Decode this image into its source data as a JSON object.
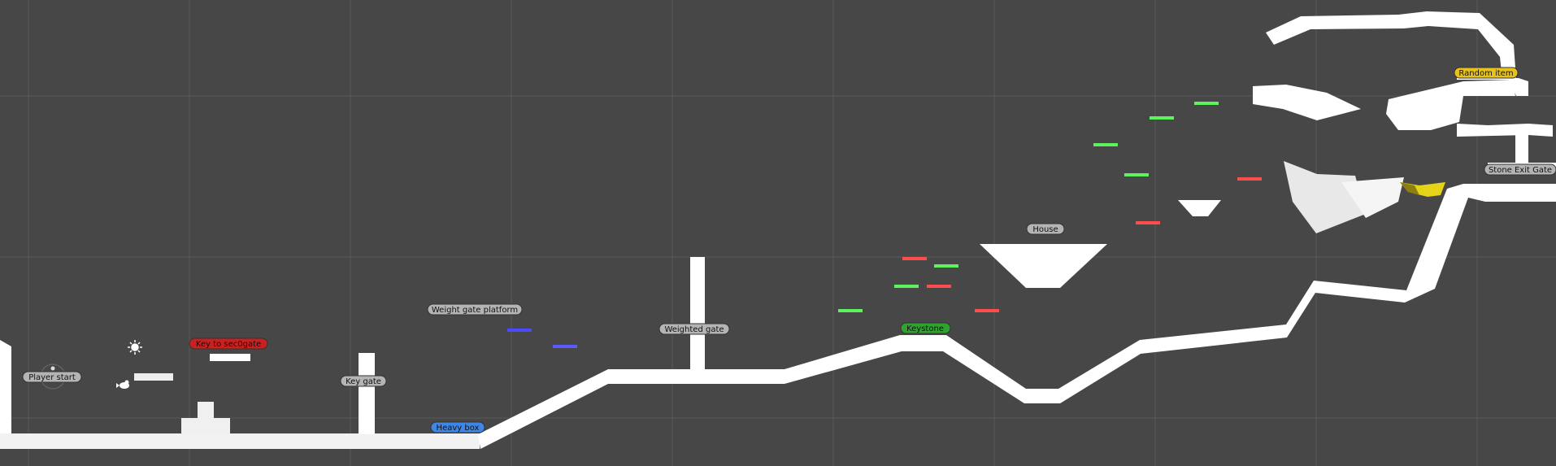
{
  "labels": {
    "player_start": "Player start",
    "key_to_gate": "Key to sec0gate",
    "key_gate": "Key gate",
    "heavy_box": "Heavy box",
    "weight_gate_platform": "Weight gate platform",
    "weighted_gate": "Weighted gate",
    "keystone": "Keystone",
    "house": "House",
    "stone_exit_gate": "Stone Exit Gate",
    "random_item": "Random item"
  },
  "colors": {
    "background": "#474747",
    "grid": "#5a5a5a",
    "geometry": "#ffffff",
    "label_gray": "#b4b4b4",
    "label_red": "#cc1f1f",
    "label_blue": "#3f86e6",
    "label_green": "#2ea32e",
    "label_yellow": "#e8c21c",
    "platform_green": "#5ef35e",
    "platform_red": "#ff4d4d",
    "platform_blue": "#4a4aff"
  },
  "icons": [
    "sun-light-icon",
    "bird-icon",
    "player-gizmo-icon"
  ]
}
